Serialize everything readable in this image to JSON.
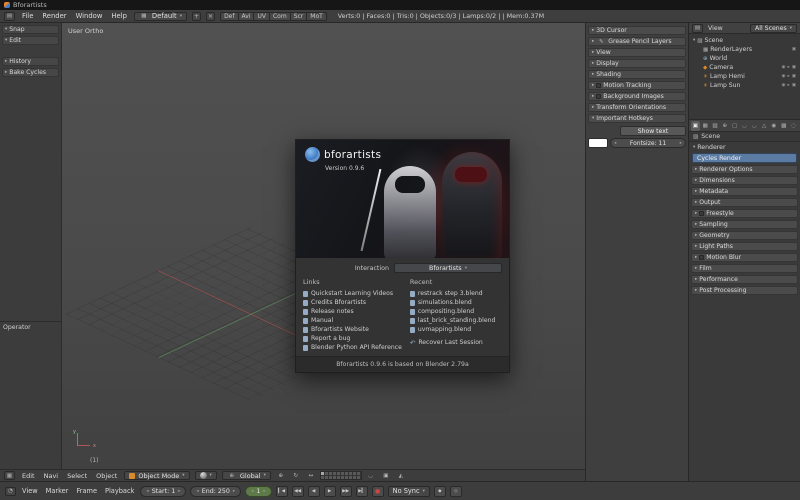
{
  "window": {
    "title": "Bforartists"
  },
  "menubar": {
    "menus": [
      "File",
      "Render",
      "Window",
      "Help"
    ],
    "layout": "Default",
    "new_layout": "+",
    "delete_layout": "×",
    "layout_tabs": [
      "Def",
      "Avi",
      "UV",
      "Com",
      "Scr",
      "MoT"
    ],
    "stats": "Verts:0 | Faces:0 | Tris:0 | Objects:0/3 | Lamps:0/2 | | Mem:0.37M"
  },
  "tool_shelf": {
    "panels": [
      "Snap",
      "Edit",
      "History",
      "Bake Cycles"
    ],
    "operator": "Operator"
  },
  "viewport": {
    "view_label": "User Ortho",
    "layer_indicator": "(1)"
  },
  "splash": {
    "logo_text": "bforartists",
    "version": "Version 0.9.6",
    "interaction_label": "Interaction",
    "interaction_value": "Bforartists",
    "links_title": "Links",
    "links": [
      "Quickstart Learning Videos",
      "Credits Bforartists",
      "Release notes",
      "Manual",
      "Bforartists Website",
      "Report a bug",
      "Blender Python API Reference"
    ],
    "recent_title": "Recent",
    "recent": [
      "restrack step 3.blend",
      "simulations.blend",
      "compositing.blend",
      "last_brick_standing.blend",
      "uvmapping.blend"
    ],
    "recover": "Recover Last Session",
    "footer": "Bforartists 0.9.6 is based on Blender 2.79a"
  },
  "view_options": {
    "panels": [
      "3D Cursor",
      "Grease Pencil Layers",
      "View",
      "Display",
      "Shading",
      "Motion Tracking",
      "Background Images",
      "Transform Orientations",
      "Important Hotkeys"
    ],
    "show_text": "Show text",
    "fontsize_label": "Fontsize:",
    "fontsize_value": "11"
  },
  "outliner": {
    "view_menu": "View",
    "scope": "All Scenes",
    "root": "Scene",
    "items": [
      "RenderLayers",
      "World",
      "Camera",
      "Lamp Hemi",
      "Lamp Sun"
    ]
  },
  "properties": {
    "context": "Scene",
    "renderer_label": "Renderer",
    "engine": "Cycles Render",
    "panels": [
      "Renderer Options",
      "Dimensions",
      "Metadata",
      "Output",
      "Freestyle",
      "Sampling",
      "Geometry",
      "Light Paths",
      "Motion Blur",
      "Film",
      "Performance",
      "Post Processing"
    ]
  },
  "view_header": {
    "menus": [
      "Edit",
      "Navi",
      "Select",
      "Object"
    ],
    "mode": "Object Mode",
    "orientation": "Global"
  },
  "timeline": {
    "menus": [
      "View",
      "Marker",
      "Frame",
      "Playback"
    ],
    "start": "Start: 1",
    "end": "End: 250",
    "frame": "1",
    "sync": "No Sync"
  },
  "colors": {
    "engine_highlight": "#5b7ba3",
    "logo_blue": "#3d79c2",
    "axis_x_red": "#b25050",
    "axis_y_green": "#609660",
    "object_icon_orange": "#d98a2b"
  }
}
